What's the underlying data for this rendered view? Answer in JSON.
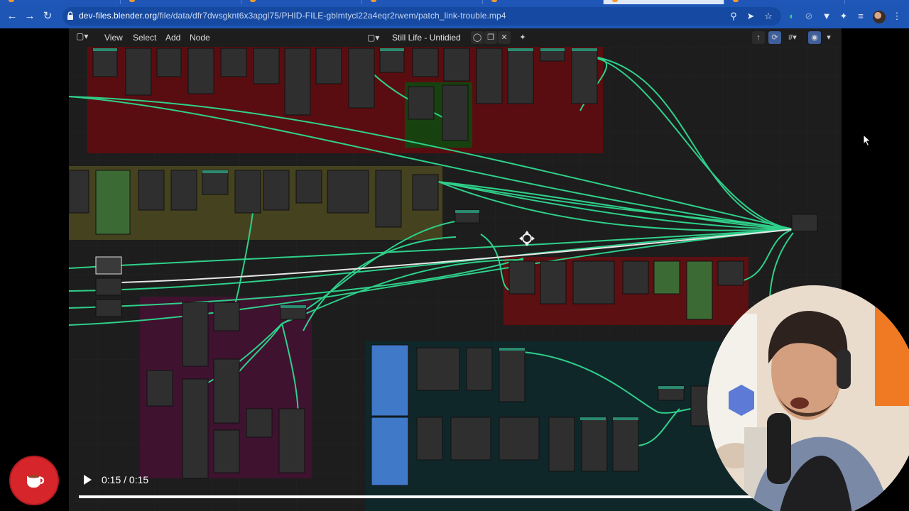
{
  "browser": {
    "url_host": "dev-files.blender.org",
    "url_path": "/file/data/dfr7dwsgknt6x3apgl75/PHID-FILE-gblmtycl22a4eqr2rwem/patch_link-trouble.mp4",
    "icons": [
      "back-arrow-icon",
      "forward-arrow-icon",
      "reload-icon",
      "site-info-icon",
      "zoom-icon",
      "share-icon",
      "bookmark-star-icon",
      "extension-icon",
      "puzzle-icon",
      "reading-list-icon",
      "profile-avatar",
      "menu-dots-icon"
    ]
  },
  "blender": {
    "menus": [
      "View",
      "Select",
      "Add",
      "Node"
    ],
    "scene_name": "Still Life - Untidied",
    "editor_icon": "node-editor-icon",
    "header_buttons": [
      "shield-icon",
      "duplicate-icon",
      "close-icon",
      "pin-icon"
    ],
    "right_buttons": [
      "parent-node-icon",
      "snap-icon",
      "overlay-icon",
      "gizmo-icon"
    ]
  },
  "video": {
    "time": "0:15 / 0:15",
    "progress": 1.0,
    "play_icon": "play-icon"
  },
  "colors": {
    "chrome_bg": "#1e56b6",
    "link": "#2fd08a",
    "frame_red": "#6a0d10",
    "frame_olive": "#4a4a24",
    "frame_purple": "#451433",
    "frame_teal": "#0f2a2c",
    "frame_green": "#17420f",
    "node_blue": "#3f79c7",
    "node_green": "#3f8a3a",
    "coffee_red": "#d6252b"
  }
}
